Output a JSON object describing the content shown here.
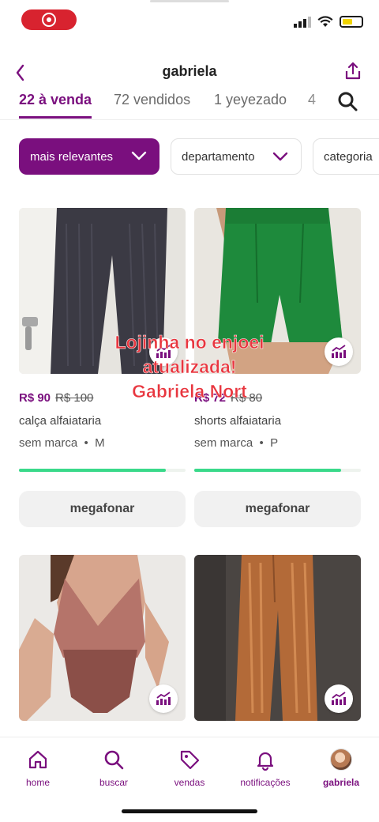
{
  "header": {
    "title": "gabriela"
  },
  "tabs": [
    {
      "label": "22 à venda",
      "active": true
    },
    {
      "label": "72 vendidos",
      "active": false
    },
    {
      "label": "1 yeyezado",
      "active": false
    },
    {
      "label": "4",
      "active": false
    }
  ],
  "filters": {
    "sort": "mais relevantes",
    "department": "departamento",
    "category": "categoria"
  },
  "products": [
    {
      "price": "R$ 90",
      "old_price": "R$ 100",
      "title": "calça alfaiataria",
      "brand": "sem marca",
      "size": "M",
      "progress": 0.88,
      "action": "megafonar"
    },
    {
      "price": "R$ 72",
      "old_price": "R$ 80",
      "title": "shorts alfaiataria",
      "brand": "sem marca",
      "size": "P",
      "progress": 0.88,
      "action": "megafonar"
    },
    {
      "price": "",
      "old_price": "",
      "title": "",
      "brand": "",
      "size": "",
      "progress": null,
      "action": ""
    },
    {
      "price": "",
      "old_price": "",
      "title": "",
      "brand": "",
      "size": "",
      "progress": null,
      "action": ""
    }
  ],
  "overlay": {
    "line1": "Lojinha no enjoei",
    "line2": "atualizada!",
    "line3": "Gabriela Nort"
  },
  "bottom_nav": [
    {
      "label": "home",
      "icon": "home-icon"
    },
    {
      "label": "buscar",
      "icon": "search-icon"
    },
    {
      "label": "vendas",
      "icon": "tag-icon"
    },
    {
      "label": "notificações",
      "icon": "bell-icon"
    },
    {
      "label": "gabriela",
      "icon": "avatar",
      "active": true
    }
  ],
  "colors": {
    "brand": "#7a0f7e",
    "progress": "#39d98a",
    "overlay_text": "#e8363f"
  }
}
